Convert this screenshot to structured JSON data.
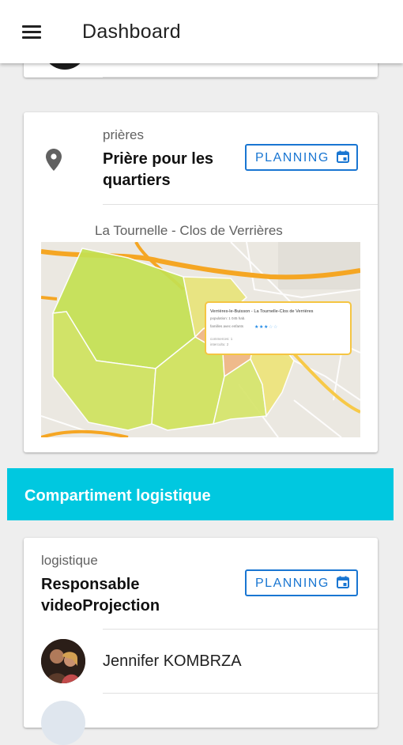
{
  "appbar": {
    "title": "Dashboard",
    "menu_icon": "menu-icon"
  },
  "card1": {
    "category": "prières",
    "title": "Prière pour les quartiers",
    "planning_label": "PLANNING",
    "icon": "location-pin-icon",
    "map_caption": "La Tournelle - Clos de Verrières",
    "map_popup": {
      "title": "Verrières-le-Buisson - La Tournelle-Clos de Verrières",
      "population": "population: 1 045 hab.",
      "families": "familles avec enfants",
      "rating_stars": 3,
      "rating_max": 5,
      "line1": "commerces: 1",
      "line2": "intercultu: 2"
    }
  },
  "section": {
    "title": "Compartiment logistique"
  },
  "card2": {
    "category": "logistique",
    "title": "Responsable videoProjection",
    "planning_label": "PLANNING",
    "members": [
      {
        "name": "Jennifer KOMBRZA"
      }
    ]
  },
  "colors": {
    "accent": "#1976d2",
    "section_bg": "#00c8e0",
    "zone_green": "#d4e157",
    "zone_orange": "#f0b27a"
  }
}
